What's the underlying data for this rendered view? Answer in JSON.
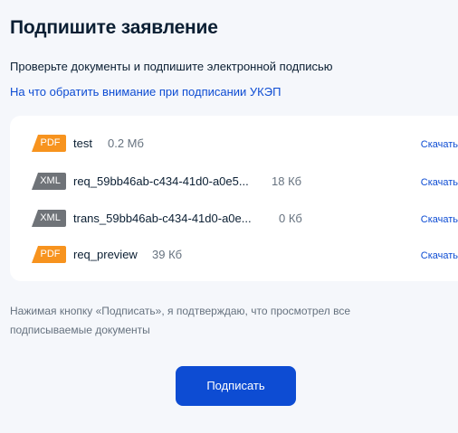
{
  "header": {
    "title": "Подпишите заявление",
    "subtitle": "Проверьте документы и подпишите электронной подписью",
    "info_link": "На что обратить внимание при подписании УКЭП"
  },
  "files": [
    {
      "type": "PDF",
      "name": "test",
      "size": "0.2 Мб",
      "download_label": "Скачать",
      "badge_color": "#f7931e"
    },
    {
      "type": "XML",
      "name": "req_59bb46ab-c434-41d0-a0e5...",
      "size": "18 Кб",
      "download_label": "Скачать",
      "badge_color": "#6f7378"
    },
    {
      "type": "XML",
      "name": "trans_59bb46ab-c434-41d0-a0e...",
      "size": "0 Кб",
      "download_label": "Скачать",
      "badge_color": "#6f7378"
    },
    {
      "type": "PDF",
      "name": "req_preview",
      "size": "39 Кб",
      "download_label": "Скачать",
      "badge_color": "#f7931e"
    }
  ],
  "note": "Нажимая кнопку «Подписать», я подтверждаю, что просмотрел все подписываемые документы",
  "sign_button_label": "Подписать",
  "colors": {
    "accent": "#0d4cd3",
    "pdf_badge": "#f7931e",
    "xml_badge": "#6f7378",
    "background": "#f5f7fb"
  }
}
